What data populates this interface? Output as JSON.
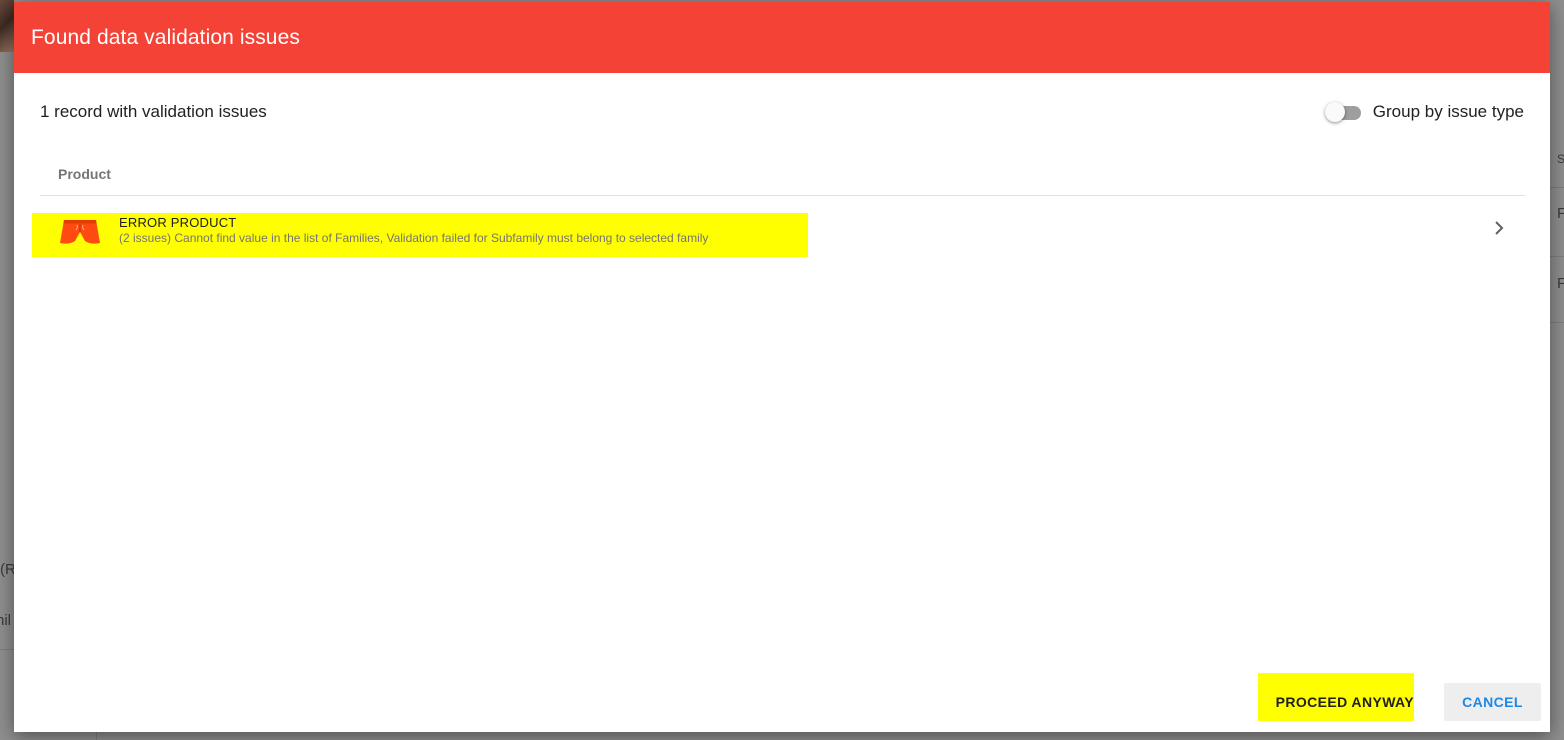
{
  "dialog": {
    "title": "Found data validation issues",
    "header_color": "#f44336"
  },
  "summary": {
    "record_count": "1 record with validation issues",
    "group_toggle_label": "Group by issue type",
    "group_toggle_on": false
  },
  "table": {
    "column_header": "Product",
    "rows": [
      {
        "name": "ERROR PRODUCT",
        "issues": "(2 issues) Cannot find value in the list of Families, Validation failed for Subfamily must belong to selected family",
        "thumbnail_icon": "shorts-thumbnail"
      }
    ]
  },
  "footer": {
    "proceed_label": "PROCEED ANYWAY",
    "cancel_label": "CANCEL"
  },
  "background": {
    "fragments": [
      "(R",
      "nil",
      "S",
      "F",
      "F"
    ]
  },
  "colors": {
    "highlight": "#ffff00",
    "accent_blue": "#1e88e5"
  }
}
